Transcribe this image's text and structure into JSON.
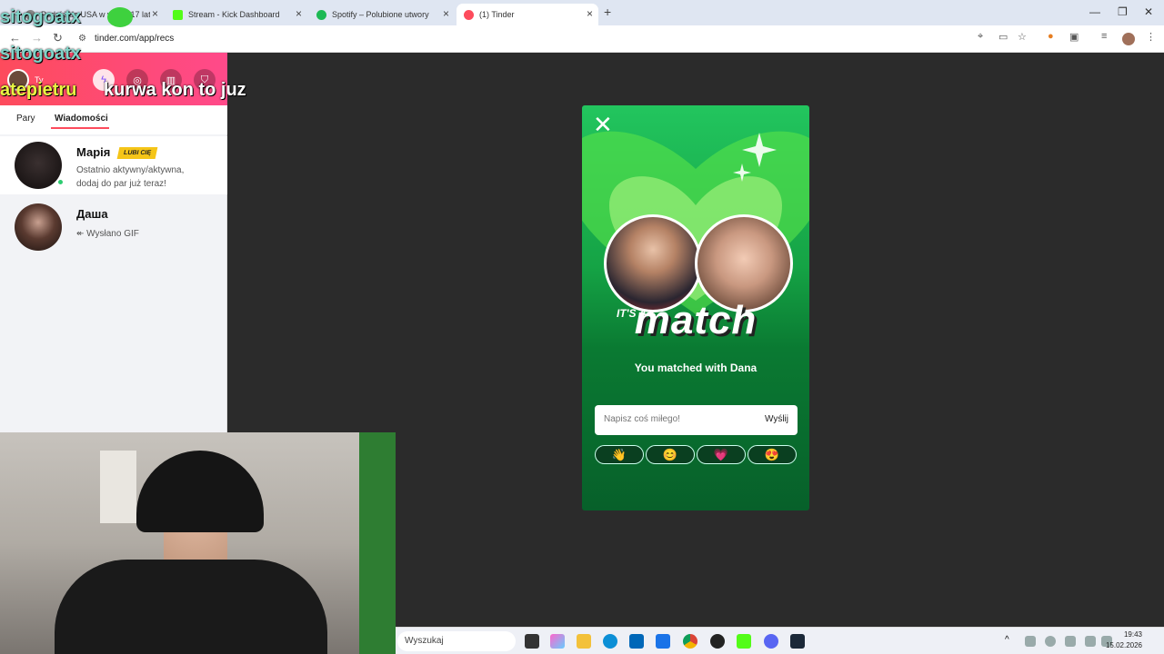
{
  "browser": {
    "tabs": [
      {
        "title": "Podróż do USA w wieku 17 lat",
        "color": "#888888"
      },
      {
        "title": "Stream - Kick Dashboard",
        "color": "#53fc18"
      },
      {
        "title": "Spotify – Polubione utwory",
        "color": "#1db954"
      },
      {
        "title": "(1) Tinder",
        "color": "#fd4b5c"
      }
    ],
    "url": "tinder.com/app/recs"
  },
  "sidebar": {
    "profile_label": "Ty",
    "tabs": {
      "pairs": "Pary",
      "messages": "Wiadomości"
    },
    "matches": [
      {
        "name": "Марія",
        "badge": "LUBI CIĘ",
        "line1": "Ostatnio aktywny/aktywna,",
        "line2": "dodaj do par już teraz!"
      },
      {
        "name": "Даша",
        "line1": "↞ Wysłano GIF"
      }
    ]
  },
  "overlay": {
    "name1": "sitogoatx",
    "name2": "sitogoatx",
    "name3": "atepietru",
    "chat": "kurwa kon to juz"
  },
  "modal": {
    "close": "✕",
    "its_a": "IT'S A",
    "headline": "match",
    "matched_with": "You matched with Dana",
    "input_placeholder": "Napisz coś miłego!",
    "send_label": "Wyślij",
    "reactions": [
      "👋",
      "😊",
      "💗",
      "😍"
    ]
  },
  "taskbar": {
    "search_placeholder": "Wyszukaj",
    "time": "19:43",
    "date": "15.02.2026"
  }
}
